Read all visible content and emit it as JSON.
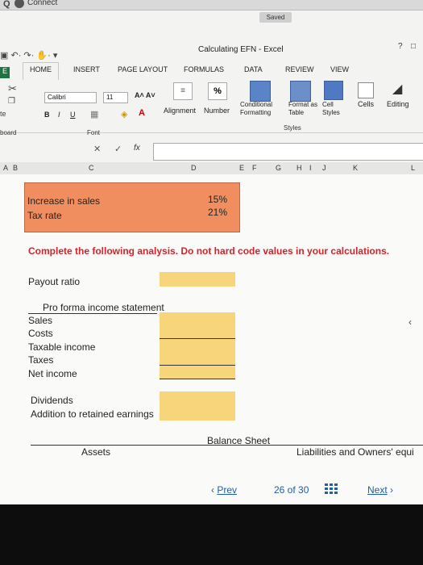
{
  "app": {
    "connect_label": "Connect",
    "saved_label": "Saved",
    "window_title": "Calculating EFN - Excel",
    "help_label": "?"
  },
  "ribbon": {
    "tabs": [
      "E",
      "HOME",
      "INSERT",
      "PAGE LAYOUT",
      "FORMULAS",
      "DATA",
      "REVIEW",
      "VIEW"
    ],
    "font_name": "Calibri",
    "font_size": "11",
    "bold": "B",
    "italic": "I",
    "underline": "U",
    "grow_font": "A˄ A˅",
    "alignment": "Alignment",
    "number": "Number",
    "percent": "%",
    "conditional": "Conditional Formatting",
    "format_as": "Format as Table",
    "cell_styles": "Cell Styles",
    "cells": "Cells",
    "editing": "Editing",
    "clipboard_group": "board",
    "font_group": "Font",
    "styles_group": "Styles",
    "paste_fragment": "te"
  },
  "formula_bar": {
    "cancel": "✕",
    "enter": "✓",
    "fx": "fx"
  },
  "columns": [
    "A",
    "B",
    "C",
    "D",
    "E",
    "F",
    "G",
    "H",
    "I",
    "J",
    "K",
    "L"
  ],
  "sheet": {
    "increase_label": "Increase in sales",
    "increase_value": "15%",
    "tax_label": "Tax rate",
    "tax_value": "21%",
    "instruction": "Complete the following analysis. Do not hard code values in your calculations.",
    "payout_label": "Payout ratio",
    "proforma_title": "Pro forma income statement",
    "sales": "Sales",
    "costs": "Costs",
    "taxable": "Taxable income",
    "taxes": "Taxes",
    "net_income": "Net income",
    "dividends": "Dividends",
    "retained": "Addition to retained earnings",
    "balance_sheet": "Balance Sheet",
    "assets": "Assets",
    "liabilities": "Liabilities and Owners' equi"
  },
  "pager": {
    "prev": "Prev",
    "page": "26 of 30",
    "next": "Next"
  },
  "colors": {
    "orange": "#f08e60",
    "yellow": "#f6d57b",
    "instruction_red": "#d2232a",
    "link_blue": "#1f5ea8"
  }
}
